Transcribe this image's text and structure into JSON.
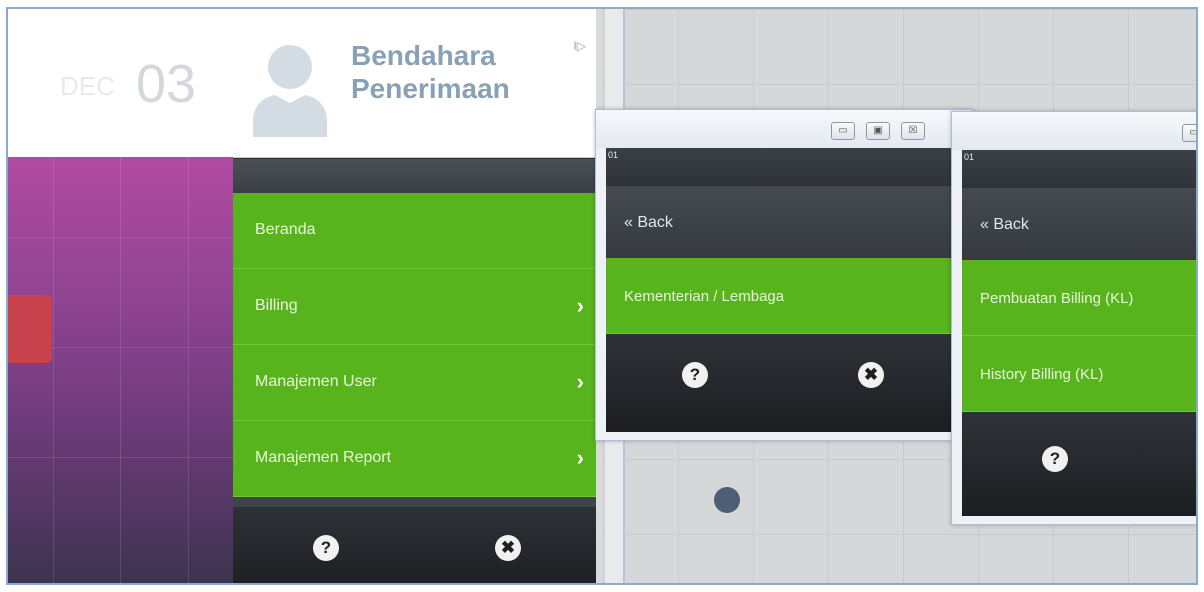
{
  "date_tile": {
    "month": "DEC",
    "day": "03"
  },
  "profile": {
    "name": "Bendahara Penerimaan",
    "logout_icon": "logout-icon"
  },
  "menu": {
    "items": [
      {
        "label": "Beranda",
        "has_arrow": false
      },
      {
        "label": "Billing",
        "has_arrow": true
      },
      {
        "label": "Manajemen User",
        "has_arrow": true
      },
      {
        "label": "Manajemen Report",
        "has_arrow": true
      }
    ],
    "help_icon": "?",
    "close_icon": "✖"
  },
  "window1": {
    "tag": "01",
    "back_label": "« Back",
    "items": [
      {
        "label": "Kementerian / Lembaga"
      }
    ],
    "help_icon": "?",
    "close_icon": "✖"
  },
  "window2": {
    "tag": "01",
    "back_label": "« Back",
    "items": [
      {
        "label": "Pembuatan Billing (KL)"
      },
      {
        "label": "History Billing (KL)"
      }
    ],
    "help_icon": "?"
  },
  "colors": {
    "green": "#58b41c",
    "dark": "#2c2f33",
    "accent_text": "#8aa0b4",
    "purple": "#8e4391"
  }
}
